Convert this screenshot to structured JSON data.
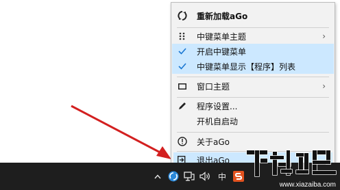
{
  "menu": {
    "items": [
      {
        "label": "重新加载aGo",
        "icon": "reload-icon"
      },
      {
        "label": "中键菜单主题",
        "icon": "grid-dots-icon",
        "submenu_arrow": "›"
      },
      {
        "label": "开启中键菜单",
        "icon": "checkmark-icon"
      },
      {
        "label": "中键菜单显示【程序】列表",
        "icon": "checkmark-icon"
      },
      {
        "label": "窗口主题",
        "icon": "window-icon",
        "submenu_arrow": "›"
      },
      {
        "label": "程序设置...",
        "icon": "pencil-icon"
      },
      {
        "label": "开机自启动",
        "icon": ""
      },
      {
        "label": "关于aGo",
        "icon": "info-icon"
      },
      {
        "label": "退出aGo",
        "icon": "exit-icon"
      }
    ]
  },
  "taskbar": {
    "ime_label": "中",
    "icons": [
      "chevron-up-icon",
      "ago-tray-icon",
      "network-icon",
      "volume-icon",
      "ime-indicator",
      "app-tray-icon"
    ]
  },
  "watermark": {
    "text": "www.xiazaiba.com"
  },
  "colors": {
    "highlight": "#cce8ff",
    "check": "#1976d2",
    "arrow": "#d32020",
    "taskbar": "#1e1e1e"
  }
}
